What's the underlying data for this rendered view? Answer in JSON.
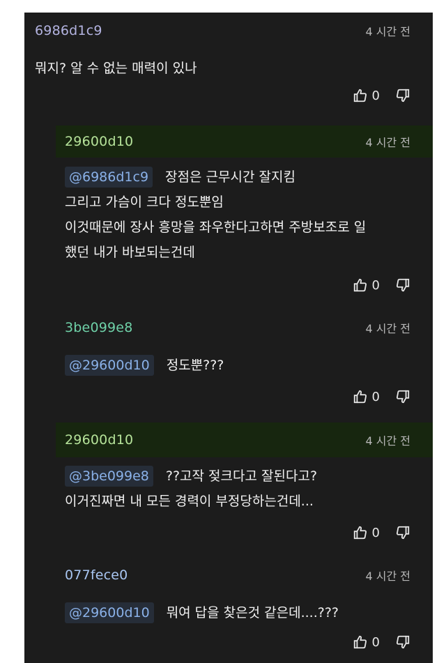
{
  "colors": {
    "background": "#1c1c1c",
    "highlight": "#17260f",
    "author_grey": "#b3b3e0",
    "author_green": "#b6e39a",
    "author_teal": "#6fd1a8",
    "author_blue": "#a9c6f2",
    "mention_text": "#8ab1e8"
  },
  "comments": [
    {
      "author": "6986d1c9",
      "time": "4 시간 전",
      "text_lines": [
        "뭐지? 알 수 없는 매력이 있나"
      ],
      "likes": "0"
    },
    {
      "author": "29600d10",
      "time": "4 시간 전",
      "mention": "@6986d1c9",
      "text_lines": [
        "장점은 근무시간 잘지킴",
        "그리고 가슴이 크다 정도뿐임",
        "이것때문에 장사 흥망을 좌우한다고하면 주방보조로 일",
        "했던 내가 바보되는건데"
      ],
      "likes": "0"
    },
    {
      "author": "3be099e8",
      "time": "4 시간 전",
      "mention": "@29600d10",
      "text_lines": [
        "정도뿐???"
      ],
      "likes": "0"
    },
    {
      "author": "29600d10",
      "time": "4 시간 전",
      "mention": "@3be099e8",
      "text_lines": [
        "??고작 젖크다고 잘된다고?",
        "이거진짜면 내 모든 경력이 부정당하는건데..."
      ],
      "likes": "0"
    },
    {
      "author": "077fece0",
      "time": "4 시간 전",
      "mention": "@29600d10",
      "text_lines": [
        "뭐여 답을 찾은것 같은데....???"
      ],
      "likes": "0"
    }
  ]
}
